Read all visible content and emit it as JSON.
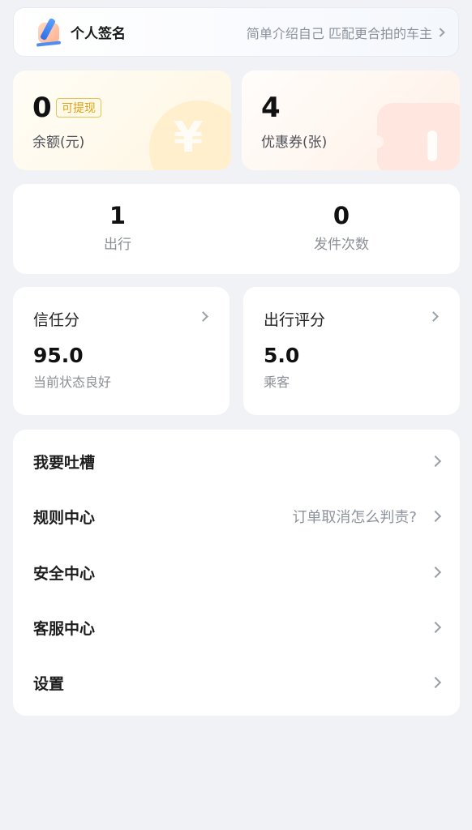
{
  "signature": {
    "title": "个人签名",
    "hint": "简单介绍自己 匹配更合拍的车主"
  },
  "balance": {
    "value": "0",
    "badge": "可提现",
    "label": "余额(元)",
    "deco_symbol": "¥"
  },
  "coupon": {
    "value": "4",
    "label": "优惠券(张)"
  },
  "trips": [
    {
      "value": "1",
      "label": "出行"
    },
    {
      "value": "0",
      "label": "发件次数"
    }
  ],
  "trust_score": {
    "title": "信任分",
    "value": "95.0",
    "status": "当前状态良好"
  },
  "trip_rating": {
    "title": "出行评分",
    "value": "5.0",
    "role": "乘客"
  },
  "menu": [
    {
      "label": "我要吐槽",
      "hint": ""
    },
    {
      "label": "规则中心",
      "hint": "订单取消怎么判责?"
    },
    {
      "label": "安全中心",
      "hint": ""
    },
    {
      "label": "客服中心",
      "hint": ""
    },
    {
      "label": "设置",
      "hint": ""
    }
  ],
  "colors": {
    "background": "#f0f2f6",
    "badge": "#d9a21a",
    "muted_text": "#8b8f96"
  },
  "icons": {
    "signature": "pen-signature-icon",
    "chevron": "chevron-right-icon",
    "balance_deco": "yuan-coin-icon",
    "coupon_deco": "ticket-icon"
  }
}
